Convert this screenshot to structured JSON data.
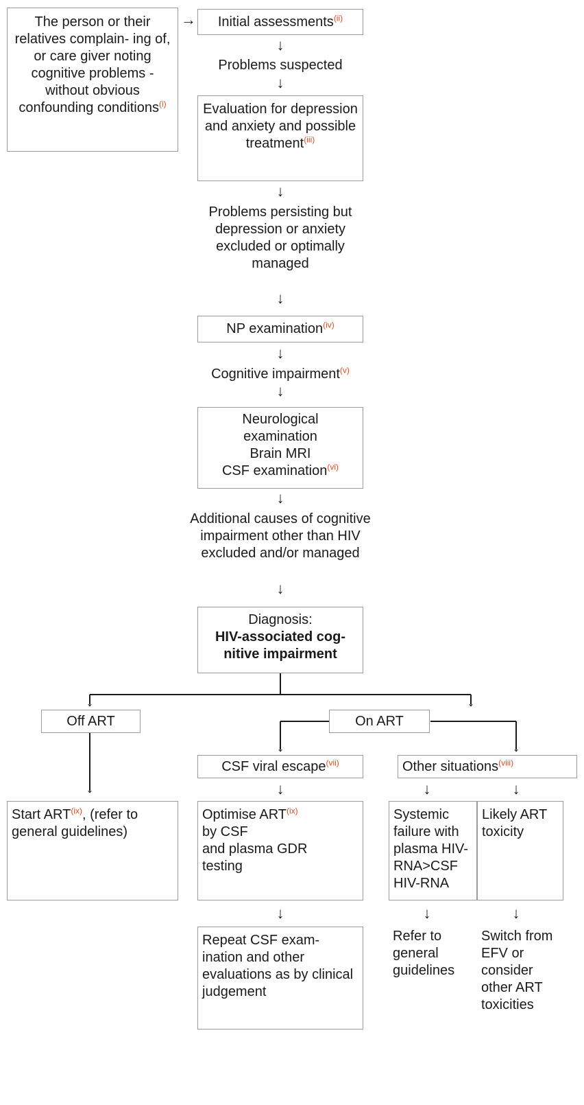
{
  "diagram": {
    "title": "HIV-associated cognitive impairment diagnostic flowchart",
    "accent_color": "#e8491d",
    "border_color": "#9a9a9a",
    "text_color": "#1a1a1a"
  },
  "nodes": {
    "person_complaint": {
      "text": "The person or their relatives complain- ing of, or care giver noting cognitive problems - without obvious confounding conditions",
      "note": "(i)"
    },
    "initial_assessments": {
      "text": "Initial assessments",
      "note": "(ii)"
    },
    "problems_suspected": {
      "text": "Problems suspected"
    },
    "evaluation_depression": {
      "text": "Evaluation for depression and anxiety and possible treatment",
      "note": "(iii)"
    },
    "problems_persisting": {
      "text": "Problems persisting but depression or anxiety excluded or optimally managed"
    },
    "np_examination": {
      "text": "NP examination",
      "note": "(iv)"
    },
    "cognitive_impairment": {
      "text": "Cognitive impairment",
      "note": "(v)"
    },
    "neuro_exam": {
      "line1": "Neurological",
      "line2": "examination",
      "line3": "Brain MRI",
      "line4": "CSF examination",
      "note": "(vi)"
    },
    "additional_causes": {
      "text": "Additional causes of cognitive impairment other than HIV excluded and/or managed"
    },
    "diagnosis": {
      "label": "Diagnosis:",
      "value": "HIV-associated cog- nitive impairment"
    },
    "off_art": {
      "text": "Off ART"
    },
    "on_art": {
      "text": "On ART"
    },
    "csf_viral_escape": {
      "text": "CSF viral escape",
      "note": "(vii)"
    },
    "other_situations": {
      "text": "Other situations",
      "note": "(viii)"
    },
    "start_art": {
      "prefix": "Start ART",
      "note": "(ix)",
      "suffix": ", (refer to general guidelines)"
    },
    "optimise_art": {
      "prefix": "Optimise ART",
      "note": "(ix)",
      "line2": "by CSF",
      "line3": "and plasma GDR",
      "line4": "testing"
    },
    "systemic_failure": {
      "text": "Systemic failure with plasma HIV-RNA>CSF HIV-RNA"
    },
    "likely_toxicity": {
      "text": "Likely ART toxicity"
    },
    "repeat_csf": {
      "text": "Repeat CSF exam- ination and other evaluations as by clinical judgement"
    },
    "refer_general": {
      "text": "Refer to general guidelines"
    },
    "switch_efv": {
      "text": "Switch from EFV or consider other ART toxicities"
    }
  },
  "arrows": {
    "right": "→",
    "down": "↓"
  }
}
